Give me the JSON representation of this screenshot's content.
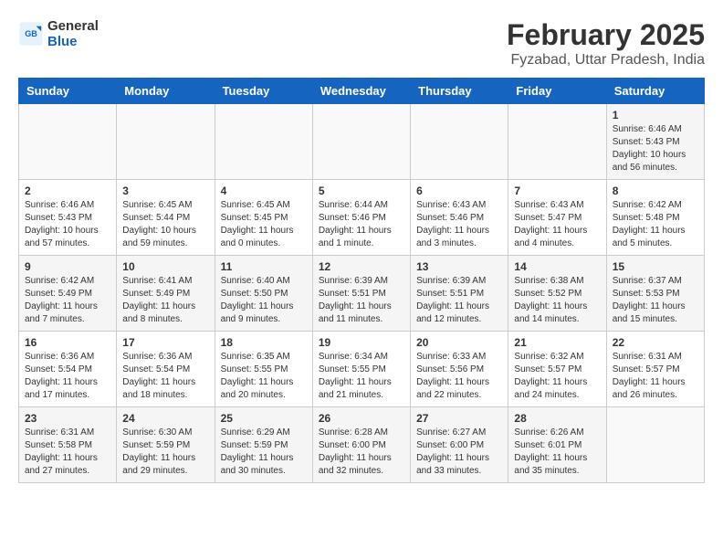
{
  "logo": {
    "line1": "General",
    "line2": "Blue"
  },
  "title": "February 2025",
  "subtitle": "Fyzabad, Uttar Pradesh, India",
  "weekdays": [
    "Sunday",
    "Monday",
    "Tuesday",
    "Wednesday",
    "Thursday",
    "Friday",
    "Saturday"
  ],
  "weeks": [
    [
      {
        "day": "",
        "info": ""
      },
      {
        "day": "",
        "info": ""
      },
      {
        "day": "",
        "info": ""
      },
      {
        "day": "",
        "info": ""
      },
      {
        "day": "",
        "info": ""
      },
      {
        "day": "",
        "info": ""
      },
      {
        "day": "1",
        "info": "Sunrise: 6:46 AM\nSunset: 5:43 PM\nDaylight: 10 hours and 56 minutes."
      }
    ],
    [
      {
        "day": "2",
        "info": "Sunrise: 6:46 AM\nSunset: 5:43 PM\nDaylight: 10 hours and 57 minutes."
      },
      {
        "day": "3",
        "info": "Sunrise: 6:45 AM\nSunset: 5:44 PM\nDaylight: 10 hours and 59 minutes."
      },
      {
        "day": "4",
        "info": "Sunrise: 6:45 AM\nSunset: 5:45 PM\nDaylight: 11 hours and 0 minutes."
      },
      {
        "day": "5",
        "info": "Sunrise: 6:44 AM\nSunset: 5:46 PM\nDaylight: 11 hours and 1 minute."
      },
      {
        "day": "6",
        "info": "Sunrise: 6:43 AM\nSunset: 5:46 PM\nDaylight: 11 hours and 3 minutes."
      },
      {
        "day": "7",
        "info": "Sunrise: 6:43 AM\nSunset: 5:47 PM\nDaylight: 11 hours and 4 minutes."
      },
      {
        "day": "8",
        "info": "Sunrise: 6:42 AM\nSunset: 5:48 PM\nDaylight: 11 hours and 5 minutes."
      }
    ],
    [
      {
        "day": "9",
        "info": "Sunrise: 6:42 AM\nSunset: 5:49 PM\nDaylight: 11 hours and 7 minutes."
      },
      {
        "day": "10",
        "info": "Sunrise: 6:41 AM\nSunset: 5:49 PM\nDaylight: 11 hours and 8 minutes."
      },
      {
        "day": "11",
        "info": "Sunrise: 6:40 AM\nSunset: 5:50 PM\nDaylight: 11 hours and 9 minutes."
      },
      {
        "day": "12",
        "info": "Sunrise: 6:39 AM\nSunset: 5:51 PM\nDaylight: 11 hours and 11 minutes."
      },
      {
        "day": "13",
        "info": "Sunrise: 6:39 AM\nSunset: 5:51 PM\nDaylight: 11 hours and 12 minutes."
      },
      {
        "day": "14",
        "info": "Sunrise: 6:38 AM\nSunset: 5:52 PM\nDaylight: 11 hours and 14 minutes."
      },
      {
        "day": "15",
        "info": "Sunrise: 6:37 AM\nSunset: 5:53 PM\nDaylight: 11 hours and 15 minutes."
      }
    ],
    [
      {
        "day": "16",
        "info": "Sunrise: 6:36 AM\nSunset: 5:54 PM\nDaylight: 11 hours and 17 minutes."
      },
      {
        "day": "17",
        "info": "Sunrise: 6:36 AM\nSunset: 5:54 PM\nDaylight: 11 hours and 18 minutes."
      },
      {
        "day": "18",
        "info": "Sunrise: 6:35 AM\nSunset: 5:55 PM\nDaylight: 11 hours and 20 minutes."
      },
      {
        "day": "19",
        "info": "Sunrise: 6:34 AM\nSunset: 5:55 PM\nDaylight: 11 hours and 21 minutes."
      },
      {
        "day": "20",
        "info": "Sunrise: 6:33 AM\nSunset: 5:56 PM\nDaylight: 11 hours and 22 minutes."
      },
      {
        "day": "21",
        "info": "Sunrise: 6:32 AM\nSunset: 5:57 PM\nDaylight: 11 hours and 24 minutes."
      },
      {
        "day": "22",
        "info": "Sunrise: 6:31 AM\nSunset: 5:57 PM\nDaylight: 11 hours and 26 minutes."
      }
    ],
    [
      {
        "day": "23",
        "info": "Sunrise: 6:31 AM\nSunset: 5:58 PM\nDaylight: 11 hours and 27 minutes."
      },
      {
        "day": "24",
        "info": "Sunrise: 6:30 AM\nSunset: 5:59 PM\nDaylight: 11 hours and 29 minutes."
      },
      {
        "day": "25",
        "info": "Sunrise: 6:29 AM\nSunset: 5:59 PM\nDaylight: 11 hours and 30 minutes."
      },
      {
        "day": "26",
        "info": "Sunrise: 6:28 AM\nSunset: 6:00 PM\nDaylight: 11 hours and 32 minutes."
      },
      {
        "day": "27",
        "info": "Sunrise: 6:27 AM\nSunset: 6:00 PM\nDaylight: 11 hours and 33 minutes."
      },
      {
        "day": "28",
        "info": "Sunrise: 6:26 AM\nSunset: 6:01 PM\nDaylight: 11 hours and 35 minutes."
      },
      {
        "day": "",
        "info": ""
      }
    ]
  ]
}
